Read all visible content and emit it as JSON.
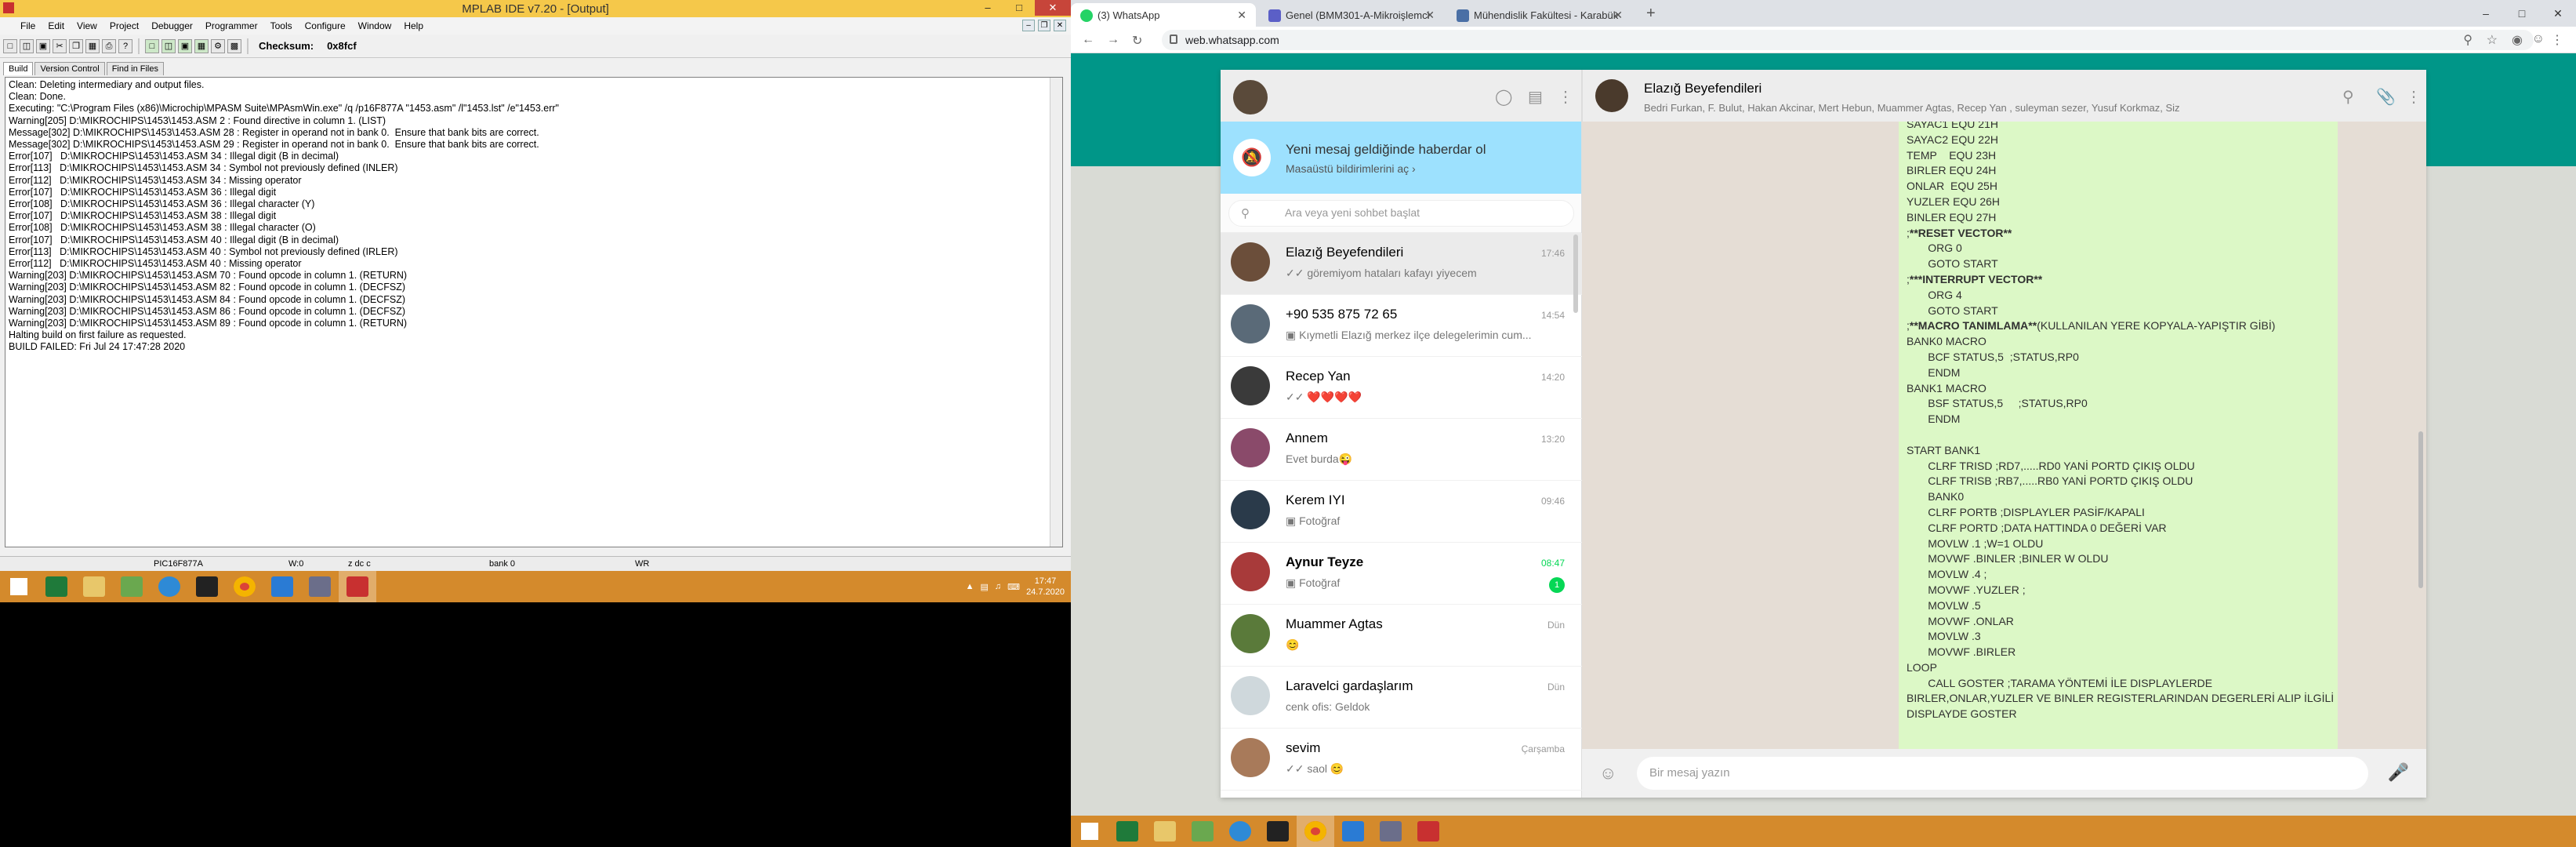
{
  "mplab": {
    "title": "MPLAB IDE v7.20 - [Output]",
    "menu": [
      "File",
      "Edit",
      "View",
      "Project",
      "Debugger",
      "Programmer",
      "Tools",
      "Configure",
      "Window",
      "Help"
    ],
    "checksum_label": "Checksum:",
    "checksum_value": "0x8fcf",
    "tabs": [
      "Build",
      "Version Control",
      "Find in Files"
    ],
    "output_lines": [
      "Clean: Deleting intermediary and output files.",
      "Clean: Done.",
      "Executing: \"C:\\Program Files (x86)\\Microchip\\MPASM Suite\\MPAsmWin.exe\" /q /p16F877A \"1453.asm\" /l\"1453.lst\" /e\"1453.err\"",
      "Warning[205] D:\\MIKROCHIPS\\1453\\1453.ASM 2 : Found directive in column 1. (LIST)",
      "Message[302] D:\\MIKROCHIPS\\1453\\1453.ASM 28 : Register in operand not in bank 0.  Ensure that bank bits are correct.",
      "Message[302] D:\\MIKROCHIPS\\1453\\1453.ASM 29 : Register in operand not in bank 0.  Ensure that bank bits are correct.",
      "Error[107]   D:\\MIKROCHIPS\\1453\\1453.ASM 34 : Illegal digit (B in decimal)",
      "Error[113]   D:\\MIKROCHIPS\\1453\\1453.ASM 34 : Symbol not previously defined (INLER)",
      "Error[112]   D:\\MIKROCHIPS\\1453\\1453.ASM 34 : Missing operator",
      "Error[107]   D:\\MIKROCHIPS\\1453\\1453.ASM 36 : Illegal digit",
      "Error[108]   D:\\MIKROCHIPS\\1453\\1453.ASM 36 : Illegal character (Y)",
      "Error[107]   D:\\MIKROCHIPS\\1453\\1453.ASM 38 : Illegal digit",
      "Error[108]   D:\\MIKROCHIPS\\1453\\1453.ASM 38 : Illegal character (O)",
      "Error[107]   D:\\MIKROCHIPS\\1453\\1453.ASM 40 : Illegal digit (B in decimal)",
      "Error[113]   D:\\MIKROCHIPS\\1453\\1453.ASM 40 : Symbol not previously defined (IRLER)",
      "Error[112]   D:\\MIKROCHIPS\\1453\\1453.ASM 40 : Missing operator",
      "Warning[203] D:\\MIKROCHIPS\\1453\\1453.ASM 70 : Found opcode in column 1. (RETURN)",
      "Warning[203] D:\\MIKROCHIPS\\1453\\1453.ASM 82 : Found opcode in column 1. (DECFSZ)",
      "Warning[203] D:\\MIKROCHIPS\\1453\\1453.ASM 84 : Found opcode in column 1. (DECFSZ)",
      "Warning[203] D:\\MIKROCHIPS\\1453\\1453.ASM 86 : Found opcode in column 1. (DECFSZ)",
      "Warning[203] D:\\MIKROCHIPS\\1453\\1453.ASM 89 : Found opcode in column 1. (RETURN)",
      "Halting build on first failure as requested.",
      "BUILD FAILED: Fri Jul 24 17:47:28 2020"
    ],
    "status": {
      "device": "PIC16F877A",
      "w": "W:0",
      "flags": "z dc c",
      "bank": "bank 0",
      "wr": "WR"
    }
  },
  "left_taskbar": {
    "time": "17:47",
    "date": "24.7.2020"
  },
  "browser": {
    "tabs": [
      {
        "title": "(3) WhatsApp",
        "icon_color": "#25d366"
      },
      {
        "title": "Genel (BMM301-A-Mikroişlemci",
        "icon_color": "#5b5fc7"
      },
      {
        "title": "Mühendislik Fakültesi - Karabük",
        "icon_color": "#4a6fa5"
      }
    ],
    "url": "web.whatsapp.com"
  },
  "whatsapp": {
    "notif_title": "Yeni mesaj geldiğinde haberdar ol",
    "notif_sub": "Masaüstü bildirimlerini aç ›",
    "search_placeholder": "Ara veya yeni sohbet başlat",
    "chats": [
      {
        "name": "Elazığ Beyefendileri",
        "time": "17:46",
        "preview": "✓✓ göremiyom hataları kafayı yiyecem",
        "selected": true,
        "color": "#6b4e3a"
      },
      {
        "name": "+90 535 875 72 65",
        "time": "14:54",
        "preview": "▣ Kıymetli Elazığ merkez ilçe delegelerimin cum...",
        "color": "#5a6a78"
      },
      {
        "name": "Recep Yan",
        "time": "14:20",
        "preview": "✓✓ ❤️❤️❤️❤️",
        "color": "#3a3a3a"
      },
      {
        "name": "Annem",
        "time": "13:20",
        "preview": "Evet burda😜",
        "color": "#8a4a6a"
      },
      {
        "name": "Kerem IYI",
        "time": "09:46",
        "preview": "▣ Fotoğraf",
        "color": "#2a3a4a"
      },
      {
        "name": "Aynur Teyze",
        "time": "08:47",
        "preview": "▣ Fotoğraf",
        "bold": true,
        "badge": "1",
        "color": "#a83a3a"
      },
      {
        "name": "Muammer Agtas",
        "time": "Dün",
        "preview": "😊",
        "color": "#5a7a3a"
      },
      {
        "name": "Laravelci gardaşlarım",
        "time": "Dün",
        "preview": "cenk ofis: Geldok",
        "color": "#cfd8dc"
      },
      {
        "name": "sevim",
        "time": "Çarşamba",
        "preview": "✓✓ saol 😊",
        "color": "#a87a5a"
      }
    ],
    "group_name": "Elazığ Beyefendileri",
    "group_members": "Bedri Furkan, F. Bulut, Hakan Akcinar, Mert Hebun, Muammer Agtas, Recep Yan , suleyman sezer, Yusuf Korkmaz, Siz",
    "message_lines": [
      "SAYAC1 EQU 21H",
      "SAYAC2 EQU 22H",
      "TEMP    EQU 23H",
      "BIRLER EQU 24H",
      "ONLAR  EQU 25H",
      "YUZLER EQU 26H",
      "BINLER EQU 27H",
      ";**RESET VECTOR**",
      "       ORG 0",
      "       GOTO START",
      ";***INTERRUPT VECTOR**",
      "       ORG 4",
      "       GOTO START",
      ";**MACRO TANIMLAMA**(KULLANILAN YERE KOPYALA-YAPIŞTIR GİBİ)",
      "BANK0 MACRO",
      "       BCF STATUS,5  ;STATUS,RP0",
      "       ENDM",
      "BANK1 MACRO",
      "       BSF STATUS,5     ;STATUS,RP0",
      "       ENDM",
      "",
      "START BANK1",
      "       CLRF TRISD ;RD7,.....RD0 YANİ PORTD ÇIKIŞ OLDU",
      "       CLRF TRISB ;RB7,.....RB0 YANİ PORTD ÇIKIŞ OLDU",
      "       BANK0",
      "       CLRF PORTB ;DISPLAYLER PASİF/KAPALI",
      "       CLRF PORTD ;DATA HATTINDA 0 DEĞERİ VAR",
      "       MOVLW .1 ;W=1 OLDU",
      "       MOVWF .BINLER ;BINLER W OLDU",
      "       MOVLW .4 ;",
      "       MOVWF .YUZLER ;",
      "       MOVLW .5",
      "       MOVWF .ONLAR",
      "       MOVLW .3",
      "       MOVWF .BIRLER",
      "LOOP",
      "       CALL GOSTER ;TARAMA YÖNTEMİ İLE DISPLAYLERDE",
      "BIRLER,ONLAR,YUZLER VE BINLER REGISTERLARINDAN DEGERLERİ ALIP İLGİLİ",
      "DISPLAYDE GOSTER"
    ],
    "compose_placeholder": "Bir mesaj yazın"
  },
  "colors": {
    "wa_green": "#009688",
    "bubble": "#dcf8c6",
    "taskbar": "#d48a2c",
    "mplab_title": "#f5c84a"
  }
}
